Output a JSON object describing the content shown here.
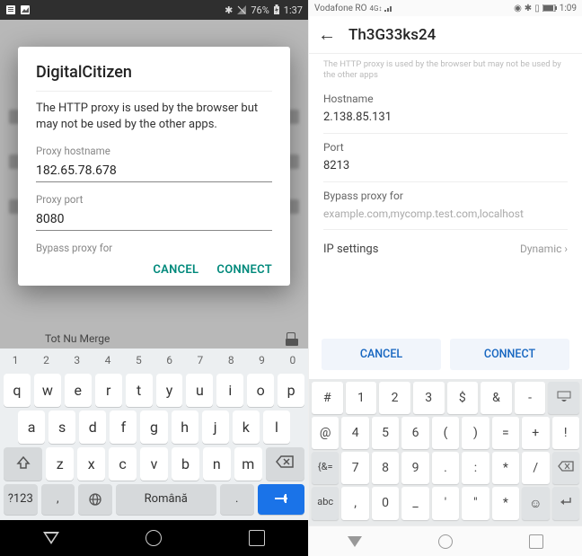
{
  "left": {
    "status": {
      "battery": "76%",
      "time": "1:37"
    },
    "dialog": {
      "title": "DigitalCitizen",
      "description": "The HTTP proxy is used by the browser but may not be used by the other apps.",
      "hostname_label": "Proxy hostname",
      "hostname_value": "182.65.78.678",
      "port_label": "Proxy port",
      "port_value": "8080",
      "bypass_label": "Bypass proxy for",
      "cancel": "CANCEL",
      "connect": "CONNECT"
    },
    "bg_network": "Tot Nu Merge",
    "keyboard": {
      "nums": [
        "1",
        "2",
        "3",
        "4",
        "5",
        "6",
        "7",
        "8",
        "9",
        "0"
      ],
      "row1": [
        "q",
        "w",
        "e",
        "r",
        "t",
        "y",
        "u",
        "i",
        "o",
        "p"
      ],
      "row2": [
        "a",
        "s",
        "d",
        "f",
        "g",
        "h",
        "j",
        "k",
        "l"
      ],
      "row3": [
        "z",
        "x",
        "c",
        "v",
        "b",
        "n",
        "m"
      ],
      "symkey": "?123",
      "comma": ",",
      "lang": "Română",
      "period": "."
    }
  },
  "right": {
    "status": {
      "carrier": "Vodafone RO",
      "time": "1:09"
    },
    "title": "Th3G33ks24",
    "cut_description": "The HTTP proxy is used by the browser but may not be used by the other apps",
    "hostname_label": "Hostname",
    "hostname_value": "2.138.85.131",
    "port_label": "Port",
    "port_value": "8213",
    "bypass_label": "Bypass proxy for",
    "bypass_placeholder": "example.com,mycomp.test.com,localhost",
    "ip_label": "IP settings",
    "ip_value": "Dynamic",
    "cancel": "CANCEL",
    "connect": "CONNECT",
    "keyboard": {
      "r1": [
        "#",
        "1",
        "2",
        "3",
        "$",
        "&",
        "-"
      ],
      "r2": [
        "@",
        "4",
        "5",
        "6",
        "(",
        ")",
        "=",
        "+",
        "!"
      ],
      "r3": [
        "{&=",
        "7",
        "8",
        "9",
        ".",
        ":",
        "*",
        "/"
      ],
      "r4": [
        "abc",
        ",",
        "0",
        "_",
        "'",
        "\"",
        "*"
      ]
    }
  }
}
